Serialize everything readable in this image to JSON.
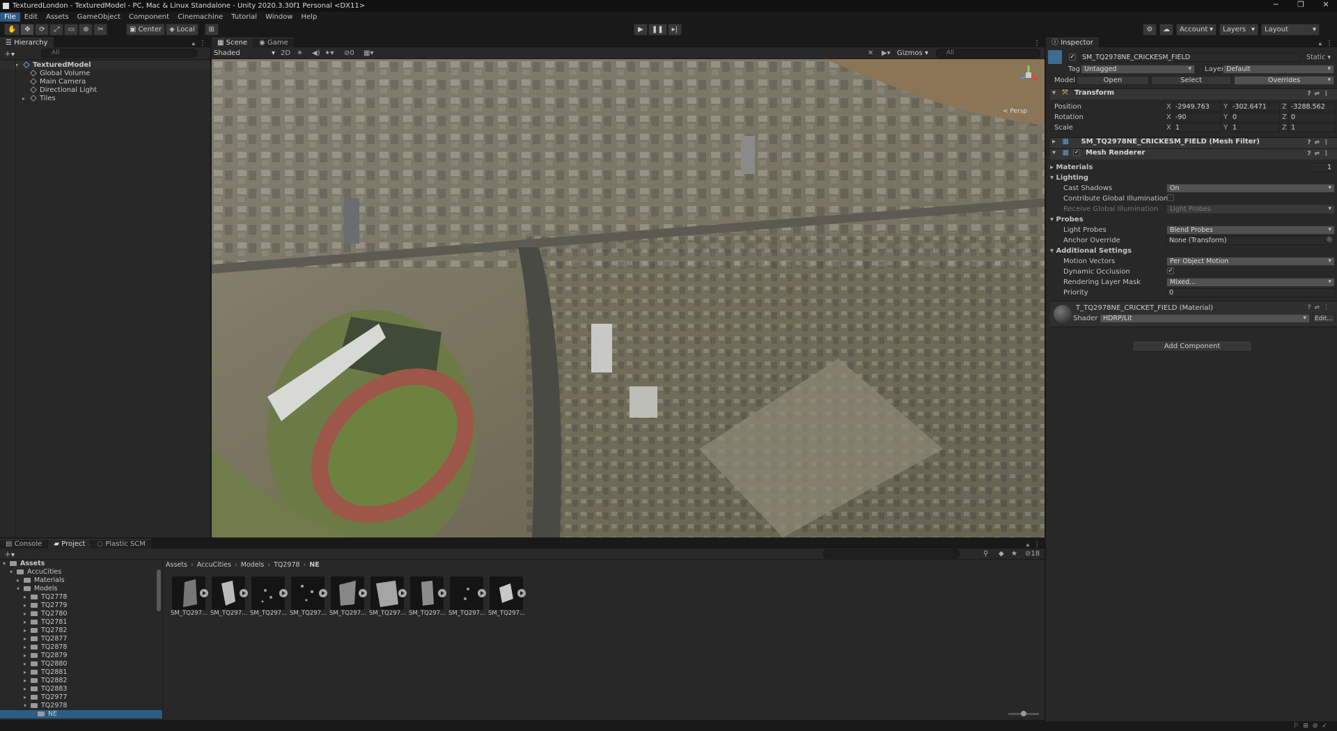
{
  "window": {
    "title": "TexturedLondon - TexturedModel - PC, Mac & Linux Standalone - Unity 2020.3.30f1 Personal <DX11>"
  },
  "menu": [
    "File",
    "Edit",
    "Assets",
    "GameObject",
    "Component",
    "Cinemachine",
    "Tutorial",
    "Window",
    "Help"
  ],
  "toolbar": {
    "pivot_label": "Center",
    "space_label": "Local",
    "account_label": "Account",
    "layers_label": "Layers",
    "layout_label": "Layout"
  },
  "hierarchy": {
    "tab": "Hierarchy",
    "search_placeholder": "All",
    "root": "TexturedModel",
    "items": [
      "Global Volume",
      "Main Camera",
      "Directional Light",
      "Tiles"
    ]
  },
  "scene": {
    "tabs": [
      "Scene",
      "Game"
    ],
    "draw_mode": "Shaded",
    "mode_2d": "2D",
    "gizmos_label": "Gizmos",
    "search_placeholder": "All",
    "persp_label": "< Persp",
    "hidden_count": "0"
  },
  "inspector": {
    "tab": "Inspector",
    "object_name": "SM_TQ2978NE_CRICKESM_FIELD",
    "static_label": "Static",
    "tag_label": "Tag",
    "tag_value": "Untagged",
    "layer_label": "Layer",
    "layer_value": "Default",
    "model_label": "Model",
    "open_label": "Open",
    "select_label": "Select",
    "overrides_label": "Overrides",
    "transform": {
      "title": "Transform",
      "position_label": "Position",
      "rotation_label": "Rotation",
      "scale_label": "Scale",
      "position": {
        "x": "-2949.763",
        "y": "-302.6471",
        "z": "-3288.562"
      },
      "rotation": {
        "x": "-90",
        "y": "0",
        "z": "0"
      },
      "scale": {
        "x": "1",
        "y": "1",
        "z": "1"
      }
    },
    "mesh_filter_title": "SM_TQ2978NE_CRICKESM_FIELD (Mesh Filter)",
    "mesh_renderer": {
      "title": "Mesh Renderer",
      "materials_label": "Materials",
      "materials_count": "1",
      "lighting_label": "Lighting",
      "cast_shadows_label": "Cast Shadows",
      "cast_shadows_value": "On",
      "contribute_gi_label": "Contribute Global Illumination",
      "receive_gi_label": "Receive Global Illumination",
      "receive_gi_value": "Light Probes",
      "probes_label": "Probes",
      "light_probes_label": "Light Probes",
      "light_probes_value": "Blend Probes",
      "anchor_override_label": "Anchor Override",
      "anchor_override_value": "None (Transform)",
      "additional_label": "Additional Settings",
      "motion_vectors_label": "Motion Vectors",
      "motion_vectors_value": "Per Object Motion",
      "dynamic_occlusion_label": "Dynamic Occlusion",
      "rendering_layer_label": "Rendering Layer Mask",
      "rendering_layer_value": "Mixed...",
      "priority_label": "Priority",
      "priority_value": "0"
    },
    "material": {
      "title": "T_TQ2978NE_CRICKET_FIELD (Material)",
      "shader_label": "Shader",
      "shader_value": "HDRP/Lit",
      "edit_label": "Edit..."
    },
    "add_component_label": "Add Component"
  },
  "bottom": {
    "tabs": [
      "Console",
      "Project",
      "Plastic SCM"
    ],
    "hidden_count": "18",
    "breadcrumb": [
      "Assets",
      "AccuCities",
      "Models",
      "TQ2978",
      "NE"
    ],
    "tree": {
      "assets": "Assets",
      "accucities": "AccuCities",
      "materials": "Materials",
      "models": "Models",
      "folders": [
        "TQ2778",
        "TQ2779",
        "TQ2780",
        "TQ2781",
        "TQ2782",
        "TQ2877",
        "TQ2878",
        "TQ2879",
        "TQ2880",
        "TQ2881",
        "TQ2882",
        "TQ2883",
        "TQ2977",
        "TQ2978"
      ],
      "selected": "NE"
    },
    "assets": [
      "SM_TQ297...",
      "SM_TQ297...",
      "SM_TQ297...",
      "SM_TQ297...",
      "SM_TQ297...",
      "SM_TQ297...",
      "SM_TQ297...",
      "SM_TQ297...",
      "SM_TQ297..."
    ]
  }
}
